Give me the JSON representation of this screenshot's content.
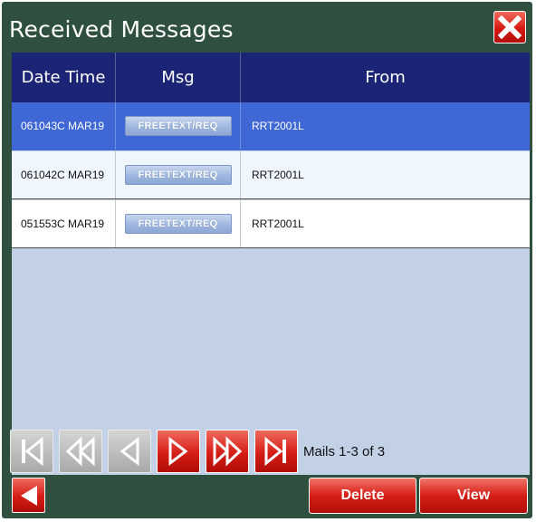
{
  "window": {
    "title": "Received Messages",
    "close_icon": "close-x-icon"
  },
  "table": {
    "columns": [
      "Date Time",
      "Msg",
      "From"
    ],
    "rows": [
      {
        "datetime": "061043C MAR19",
        "msg": "FREETEXT/REQ",
        "from": "RRT2001L",
        "selected": true
      },
      {
        "datetime": "061042C MAR19",
        "msg": "FREETEXT/REQ",
        "from": "RRT2001L",
        "selected": false
      },
      {
        "datetime": "051553C MAR19",
        "msg": "FREETEXT/REQ",
        "from": "RRT2001L",
        "selected": false
      }
    ]
  },
  "pagination": {
    "buttons": [
      "first-page-icon",
      "prev-page-fast-icon",
      "prev-page-icon",
      "next-page-icon",
      "next-page-fast-icon",
      "last-page-icon"
    ],
    "status": "Mails 1-3 of 3"
  },
  "footer": {
    "back_icon": "back-arrow-icon",
    "delete_label": "Delete",
    "view_label": "View"
  },
  "colors": {
    "window_bg": "#2f4f3f",
    "header_bg": "#1c2575",
    "selected_row": "#3f67d5",
    "list_bg": "#c3d1e7",
    "button_red": "#d41d15"
  }
}
